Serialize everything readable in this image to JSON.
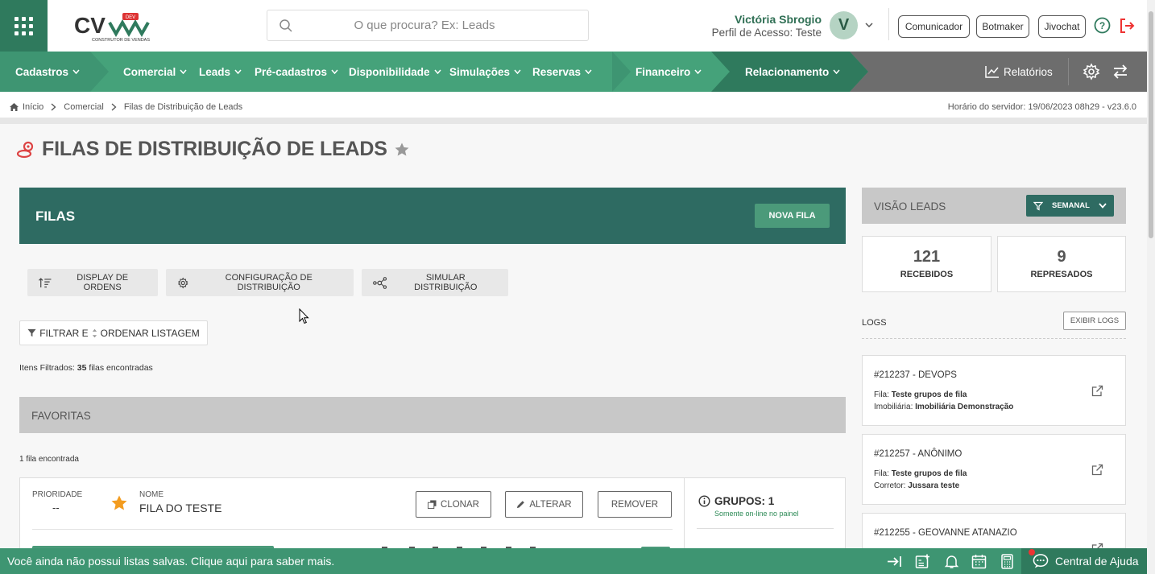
{
  "header": {
    "logo_text": "CV",
    "logo_badge": "DEV",
    "logo_tagline": "CONSTRUTOR DE VENDAS",
    "search_placeholder": "O que procura? Ex: Leads",
    "user_name": "Victória Sbrogio",
    "user_profile": "Perfil de Acesso: Teste",
    "avatar_letter": "V",
    "buttons": [
      "Comunicador",
      "Botmaker",
      "Jivochat"
    ]
  },
  "nav": {
    "items": [
      "Cadastros",
      "Comercial",
      "Leads",
      "Pré-cadastros",
      "Disponibilidade",
      "Simulações",
      "Reservas",
      "Financeiro",
      "Relacionamento"
    ],
    "reports": "Relatórios"
  },
  "breadcrumb": {
    "items": [
      "Início",
      "Comercial",
      "Filas de Distribuição de Leads"
    ],
    "server_time": "Horário do servidor: 19/06/2023 08h29 - v23.6.0"
  },
  "page": {
    "title": "FILAS DE DISTRIBUIÇÃO DE LEADS"
  },
  "filas": {
    "title": "FILAS",
    "new_button": "NOVA FILA",
    "actions": [
      "DISPLAY DE ORDENS",
      "CONFIGURAÇÃO DE DISTRIBUIÇÃO",
      "SIMULAR DISTRIBUIÇÃO"
    ],
    "filter_label": "FILTRAR E",
    "order_label": "ORDENAR LISTAGEM",
    "items_filtered_label": "Itens Filtrados:",
    "items_filtered_count": "35",
    "items_filtered_suffix": "filas encontradas"
  },
  "favorites": {
    "title": "FAVORITAS",
    "count_text": "1 fila encontrada",
    "card": {
      "priority_label": "PRIORIDADE",
      "priority_value": "--",
      "name_label": "NOME",
      "name_value": "FILA DO TESTE",
      "buttons": [
        "CLONAR",
        "ALTERAR",
        "REMOVER"
      ],
      "groups": "GRUPOS: 1",
      "groups_note": "Somente on-line no painel"
    }
  },
  "visao": {
    "title": "VISÃO LEADS",
    "period": "SEMANAL",
    "stats": [
      {
        "value": "121",
        "label": "RECEBIDOS"
      },
      {
        "value": "9",
        "label": "REPRESADOS"
      }
    ]
  },
  "logs": {
    "title": "LOGS",
    "button": "EXIBIR LOGS",
    "entries": [
      {
        "id": "#212237 - DEVOPS",
        "l1_key": "Fila:",
        "l1_val": "Teste grupos de fila",
        "l2_key": "Imobiliária:",
        "l2_val": "Imobiliária Demonstração"
      },
      {
        "id": "#212257 - ANÔNIMO",
        "l1_key": "Fila:",
        "l1_val": "Teste grupos de fila",
        "l2_key": "Corretor:",
        "l2_val": "Jussara teste"
      },
      {
        "id": "#212255 - GEOVANNE ATANAZIO",
        "l1_key": "",
        "l1_val": "",
        "l2_key": "",
        "l2_val": ""
      }
    ]
  },
  "bottom": {
    "message": "Você ainda não possui listas salvas. Clique aqui para saber mais.",
    "help_center": "Central de Ajuda"
  },
  "colors": {
    "primary_dark": "#2f7a5d",
    "primary": "#45a27a",
    "panel_teal": "#2e6b62",
    "accent_red": "#e33"
  }
}
